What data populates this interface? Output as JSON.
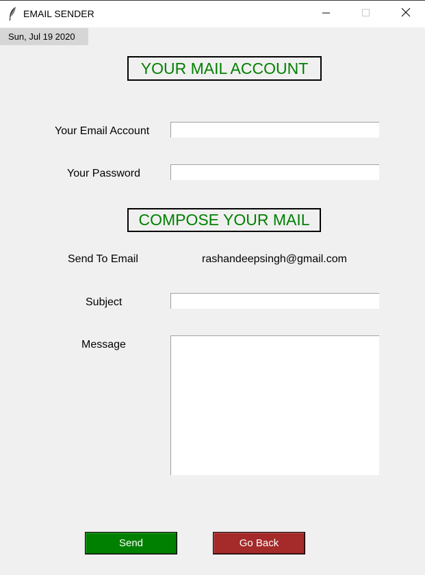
{
  "window": {
    "title": "EMAIL SENDER",
    "app_icon": "feather-icon",
    "controls": [
      "minimize-icon",
      "maximize-icon",
      "close-icon"
    ]
  },
  "date_label": "Sun, Jul 19 2020",
  "account_section": {
    "heading": "YOUR MAIL ACCOUNT",
    "email_label": "Your Email Account",
    "email_value": "",
    "password_label": "Your Password",
    "password_value": ""
  },
  "compose_section": {
    "heading": "COMPOSE YOUR MAIL",
    "to_label": "Send To Email",
    "to_value": "rashandeepsingh@gmail.com",
    "subject_label": "Subject",
    "subject_value": "",
    "message_label": "Message",
    "message_value": ""
  },
  "buttons": {
    "send_label": "Send",
    "back_label": "Go Back"
  },
  "colors": {
    "heading_text": "#008000",
    "send_button": "#008000",
    "back_button": "#a52a2a",
    "background": "#f0f0f0"
  }
}
